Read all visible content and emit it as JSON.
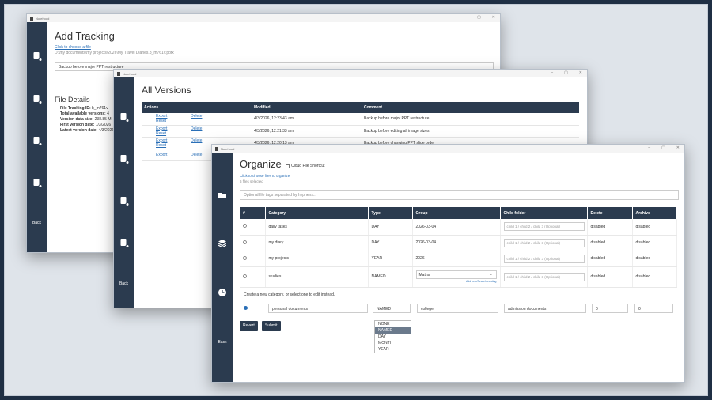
{
  "app_title": "Notehood",
  "window_controls": [
    "–",
    "▢",
    "✕"
  ],
  "back_label": "Back",
  "w1": {
    "title": "Add Tracking",
    "choose_link": "Click to choose a file",
    "file_path": "D:\\my documents\\my projects\\2026\\My Travel Diaries.b_m761v.pptx",
    "comment_value": "Backup before major PPT restructure",
    "details_title": "File Details",
    "details": [
      {
        "label": "File Tracking ID:",
        "value": "b_m761v"
      },
      {
        "label": "Total available versions:",
        "value": "4"
      },
      {
        "label": "Version data size:",
        "value": "238.85 M"
      },
      {
        "label": "First version date:",
        "value": "1/3/2026"
      },
      {
        "label": "Latest version date:",
        "value": "4/3/2026"
      }
    ]
  },
  "w2": {
    "title": "All Versions",
    "headers": [
      "Actions",
      "Modified",
      "Comment"
    ],
    "action_labels": [
      "Export",
      "Delete",
      "Reset"
    ],
    "rows": [
      {
        "modified": "4/3/2026, 12:23:43 am",
        "comment": "Backup before major PPT restructure",
        "reset": true
      },
      {
        "modified": "4/3/2026, 12:21:33 am",
        "comment": "Backup before editing all image sizes",
        "reset": true
      },
      {
        "modified": "4/3/2026, 12:20:13 am",
        "comment": "Backup before changing PPT slide order",
        "reset": true
      },
      {
        "modified": "",
        "comment": "",
        "reset": false
      }
    ]
  },
  "w3": {
    "title": "Organize",
    "cloud_checkbox": "Cloud File Shortcut",
    "choose_link": "Click to choose files to organize",
    "selected_text": "6 files selected",
    "tags_placeholder": "Optional file tags separated by hyphens...",
    "headers": [
      "#",
      "Category",
      "Type",
      "Group",
      "Child folder",
      "Delete",
      "Archive"
    ],
    "child_placeholder": "child 1 / child 2 / child 3 (Optional)",
    "rows": [
      {
        "category": "daily tasks",
        "type": "DAY",
        "group": "2026-03-04",
        "delete": "disabled",
        "archive": "disabled"
      },
      {
        "category": "my diary",
        "type": "DAY",
        "group": "2026-03-04",
        "delete": "disabled",
        "archive": "disabled"
      },
      {
        "category": "my projects",
        "type": "YEAR",
        "group": "2026",
        "delete": "disabled",
        "archive": "disabled"
      },
      {
        "category": "studies",
        "type": "NAMED",
        "group_select": "Maths",
        "group_add": "Add new/Search existing",
        "delete": "disabled",
        "archive": "disabled"
      }
    ],
    "create_text": "Create a new category, or select one to edit instead.",
    "new_row": {
      "category": "personal documents",
      "type": "NAMED",
      "group": "college",
      "child": "admission documents",
      "delete": "0",
      "archive": "0"
    },
    "type_options": [
      "NONE",
      "NAMED",
      "DAY",
      "MONTH",
      "YEAR"
    ],
    "type_selected": "NAMED",
    "revert_label": "Revert",
    "submit_label": "Submit"
  }
}
